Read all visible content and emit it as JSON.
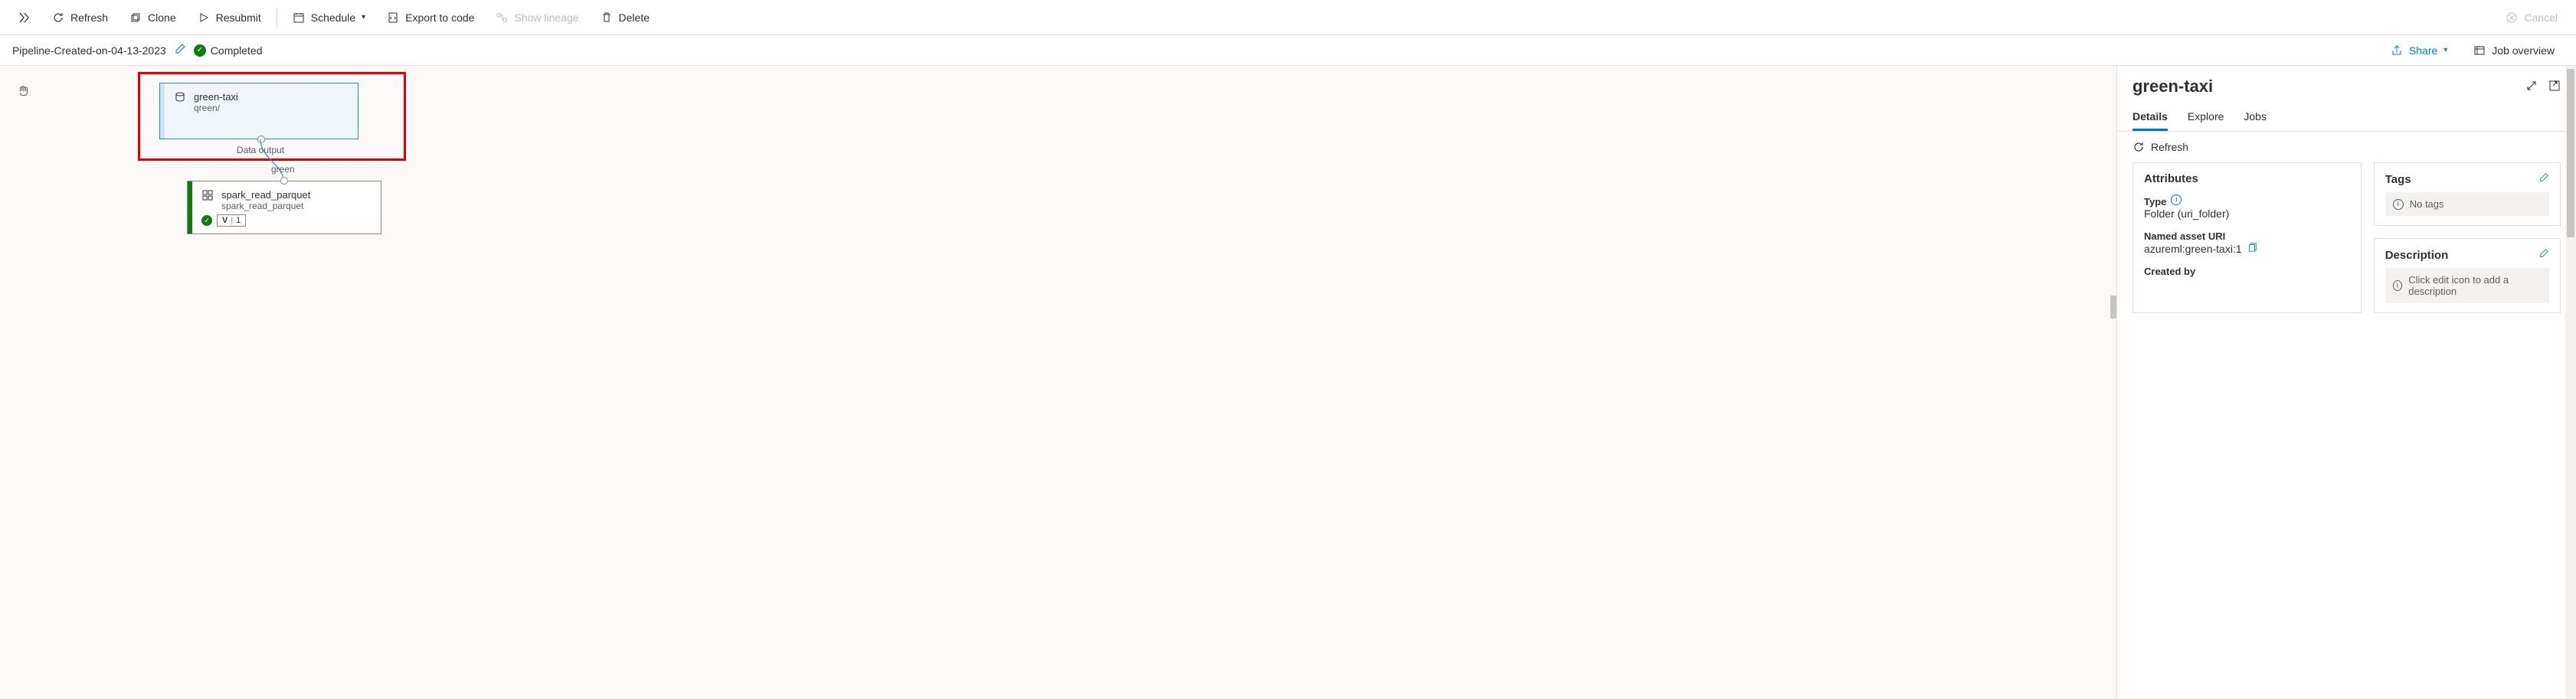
{
  "toolbar": {
    "refresh": "Refresh",
    "clone": "Clone",
    "resubmit": "Resubmit",
    "schedule": "Schedule",
    "export": "Export to code",
    "lineage": "Show lineage",
    "delete": "Delete",
    "cancel": "Cancel"
  },
  "subbar": {
    "pipeline_name": "Pipeline-Created-on-04-13-2023",
    "status": "Completed",
    "share": "Share",
    "overview": "Job overview"
  },
  "canvas": {
    "node1": {
      "title": "green-taxi",
      "sub": "qreen/",
      "out_label": "Data output"
    },
    "edge_label": "green",
    "node2": {
      "title": "spark_read_parquet",
      "sub": "spark_read_parquet",
      "ver_letter": "V",
      "ver_num": "1"
    }
  },
  "panel": {
    "title": "green-taxi",
    "tabs": {
      "details": "Details",
      "explore": "Explore",
      "jobs": "Jobs"
    },
    "refresh": "Refresh",
    "attributes": {
      "heading": "Attributes",
      "type_label": "Type",
      "type_val": "Folder (uri_folder)",
      "uri_label": "Named asset URI",
      "uri_val": "azureml:green-taxi:1",
      "createdby_label": "Created by"
    },
    "tags": {
      "heading": "Tags",
      "empty": "No tags"
    },
    "description": {
      "heading": "Description",
      "empty": "Click edit icon to add a description"
    }
  }
}
